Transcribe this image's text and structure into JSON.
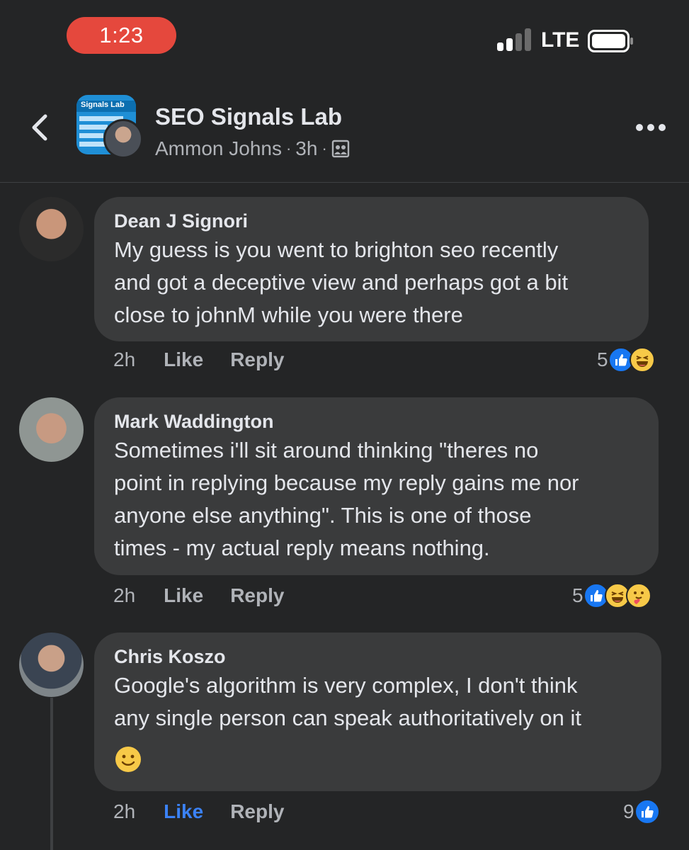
{
  "status_bar": {
    "time": "1:23",
    "network": "LTE"
  },
  "header": {
    "group_name": "SEO Signals Lab",
    "group_logo_text": "Signals Lab",
    "author": "Ammon Johns",
    "separator": "·",
    "time_ago": "3h",
    "audience_icon": "group-audience-icon",
    "back_icon": "chevron-left-icon",
    "more_icon": "more-options-icon"
  },
  "comments": [
    {
      "author": "Dean J Signori",
      "lines": [
        "My guess is you went to brighton seo recently",
        "and got a deceptive view and perhaps got a bit",
        "close to johnM while you were there"
      ],
      "time": "2h",
      "like_label": "Like",
      "reply_label": "Reply",
      "reaction_count": "5",
      "reactions": [
        "like",
        "haha"
      ],
      "liked_by_viewer": false
    },
    {
      "author": "Mark Waddington",
      "lines": [
        "Sometimes i'll sit around thinking \"theres no",
        "point in replying because my reply gains me nor",
        "anyone else anything\".  This is one of those",
        "times - my actual reply means nothing."
      ],
      "time": "2h",
      "like_label": "Like",
      "reply_label": "Reply",
      "reaction_count": "5",
      "reactions": [
        "like",
        "haha",
        "care"
      ],
      "liked_by_viewer": false
    },
    {
      "author": "Chris Koszo",
      "lines": [
        "Google's algorithm is very complex, I don't think",
        "any single person can speak authoritatively on it"
      ],
      "trailing_emoji": "slightly-smiling-face-emoji",
      "time": "2h",
      "like_label": "Like",
      "reply_label": "Reply",
      "reaction_count": "9",
      "reactions": [
        "like"
      ],
      "liked_by_viewer": true
    }
  ],
  "colors": {
    "background": "#242526",
    "bubble": "#3a3b3c",
    "time_pill": "#e5483d",
    "liked_blue": "#3b82f6",
    "meta_gray": "#b0b3b8"
  }
}
